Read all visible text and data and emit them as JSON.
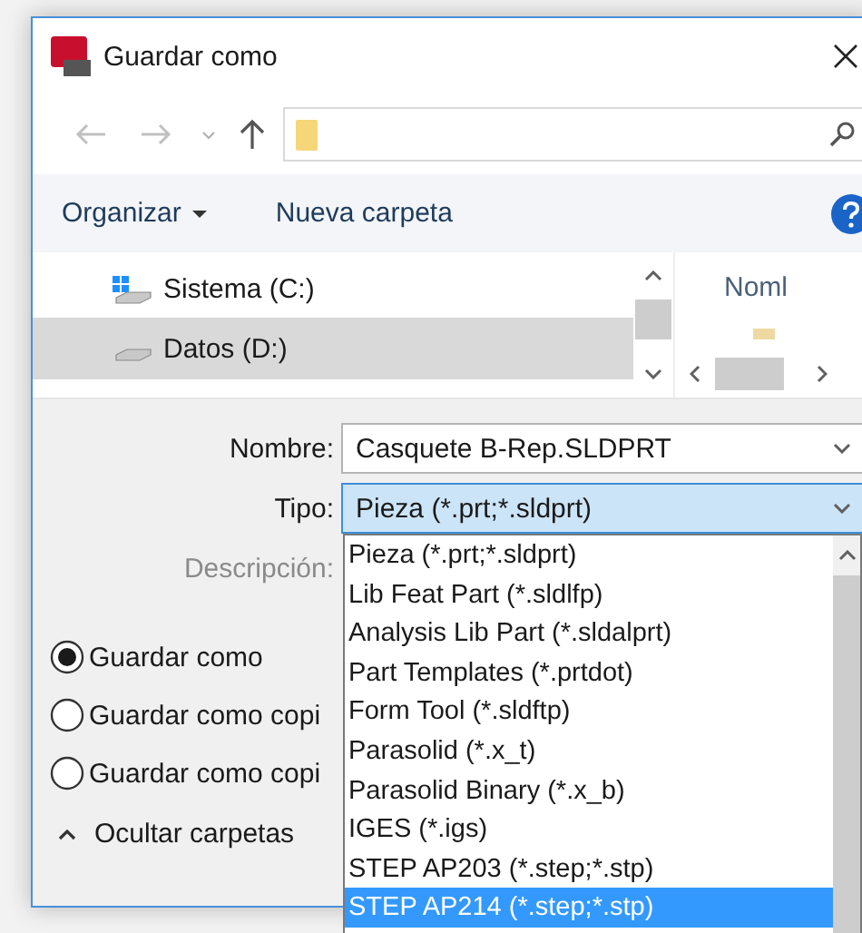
{
  "window": {
    "title": "Guardar como"
  },
  "toolbar": {
    "buttons": [
      {
        "label": "Organizar",
        "kind": "menu"
      },
      {
        "label": "Nueva carpeta",
        "kind": "plain"
      }
    ]
  },
  "nav_pane": {
    "items": [
      {
        "label": "Sistema (C:)",
        "kind": "system",
        "selected": false
      },
      {
        "label": "Datos (D:)",
        "kind": "drive",
        "selected": true
      }
    ]
  },
  "file_list": {
    "columns": [
      "Noml"
    ]
  },
  "form": {
    "fields": [
      {
        "label": "Nombre:",
        "value": "Casquete B-Rep.SLDPRT",
        "focused": false
      },
      {
        "label": "Tipo:",
        "value": "Pieza (*.prt;*.sldprt)",
        "focused": true
      }
    ],
    "description": {
      "label": "Descripción:",
      "disabled": true
    }
  },
  "dropdown": {
    "options": [
      {
        "label": "Pieza (*.prt;*.sldprt)",
        "selected": false
      },
      {
        "label": "Lib Feat Part (*.sldlfp)",
        "selected": false
      },
      {
        "label": "Analysis Lib Part (*.sldalprt)",
        "selected": false
      },
      {
        "label": "Part Templates (*.prtdot)",
        "selected": false
      },
      {
        "label": "Form Tool (*.sldftp)",
        "selected": false
      },
      {
        "label": "Parasolid (*.x_t)",
        "selected": false
      },
      {
        "label": "Parasolid Binary (*.x_b)",
        "selected": false
      },
      {
        "label": "IGES (*.igs)",
        "selected": false
      },
      {
        "label": "STEP AP203 (*.step;*.stp)",
        "selected": false
      },
      {
        "label": "STEP AP214 (*.step;*.stp)",
        "selected": true
      }
    ]
  },
  "save_options": [
    {
      "label": "Guardar como",
      "selected": true
    },
    {
      "label": "Guardar como copi",
      "selected": false
    },
    {
      "label": "Guardar como copi",
      "selected": false
    }
  ],
  "toggle_folders": {
    "label": "Ocultar carpetas"
  }
}
